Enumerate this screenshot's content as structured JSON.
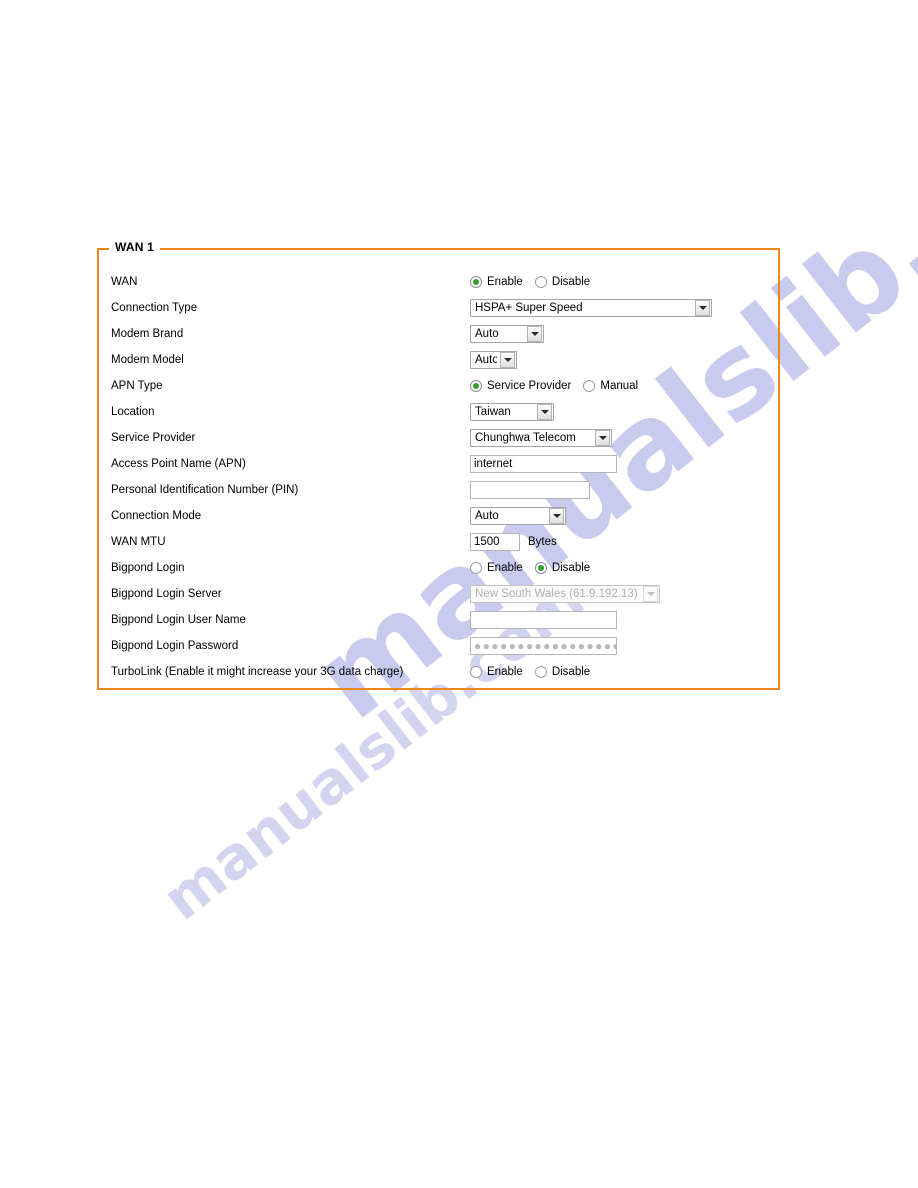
{
  "panel": {
    "legend": "WAN 1",
    "border_color": "#e8881a"
  },
  "watermark": {
    "primary": "manualslib.com",
    "secondary": "manualslib.com",
    "color": "#c9cbee"
  },
  "options": {
    "enable": "Enable",
    "disable": "Disable",
    "service_provider": "Service Provider",
    "manual": "Manual"
  },
  "rows": {
    "wan": {
      "label": "WAN",
      "value": "Enable"
    },
    "connection_type": {
      "label": "Connection Type",
      "value": "HSPA+ Super Speed"
    },
    "modem_brand": {
      "label": "Modem Brand",
      "value": "Auto"
    },
    "modem_model": {
      "label": "Modem Model",
      "value": "Auto"
    },
    "apn_type": {
      "label": "APN Type",
      "value": "Service Provider"
    },
    "location": {
      "label": "Location",
      "value": "Taiwan"
    },
    "service_provider": {
      "label": "Service Provider",
      "value": "Chunghwa Telecom"
    },
    "apn": {
      "label": "Access Point Name (APN)",
      "value": "internet"
    },
    "pin": {
      "label": "Personal Identification Number (PIN)",
      "value": ""
    },
    "connection_mode": {
      "label": "Connection Mode",
      "value": "Auto"
    },
    "wan_mtu": {
      "label": "WAN MTU",
      "value": "1500",
      "unit": "Bytes"
    },
    "bigpond_login": {
      "label": "Bigpond Login",
      "value": "Disable"
    },
    "bigpond_server": {
      "label": "Bigpond Login Server",
      "value": "New South Wales (61.9.192.13)"
    },
    "bigpond_user": {
      "label": "Bigpond Login User Name",
      "value": ""
    },
    "bigpond_password": {
      "label": "Bigpond Login Password",
      "value": "●●●●●●●●●●●●●●●●●●●●●●"
    },
    "turbolink": {
      "label": "TurboLink (Enable it might increase your 3G data charge)",
      "value": ""
    }
  }
}
